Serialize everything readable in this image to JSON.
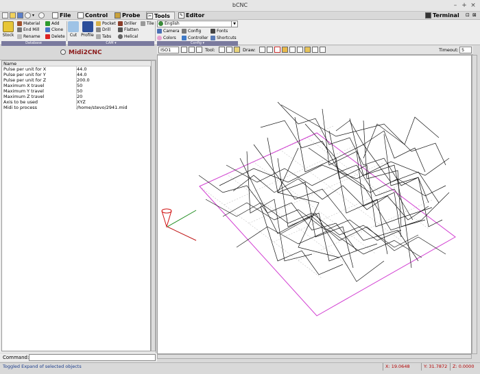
{
  "window": {
    "title": "bCNC"
  },
  "menu": {
    "tabs": [
      {
        "label": "File",
        "icon": "file-icon"
      },
      {
        "label": "Control",
        "icon": "control-icon"
      },
      {
        "label": "Probe",
        "icon": "probe-icon"
      },
      {
        "label": "Tools",
        "icon": "tools-icon"
      },
      {
        "label": "Editor",
        "icon": "editor-icon"
      }
    ],
    "terminal_label": "Terminal"
  },
  "ribbon": {
    "database": {
      "group_label": "Database",
      "stock_label": "Stock",
      "material_label": "Material",
      "endmill_label": "End Mill",
      "rename_label": "Rename",
      "add_label": "Add",
      "clone_label": "Clone",
      "delete_label": "Delete"
    },
    "cam": {
      "group_label": "CAM",
      "cut_label": "Cut",
      "profile_label": "Profile",
      "pocket_label": "Pocket",
      "drill_label": "Drill",
      "tabs_label": "Tabs",
      "driller_label": "Driller",
      "flatten_label": "Flatten",
      "helical_label": "Helical",
      "tile_label": "Tile"
    },
    "config": {
      "group_label": "Config",
      "language": "English",
      "camera_label": "Camera",
      "colors_label": "Colors",
      "config_label": "Config",
      "controller_label": "Controller",
      "fonts_label": "Fonts",
      "shortcuts_label": "Shortcuts"
    }
  },
  "panel": {
    "title": "Midi2CNC",
    "header_name": "Name",
    "rows": [
      {
        "key": "Pulse per unit for X",
        "value": "44.0"
      },
      {
        "key": "Pulse per unit for Y",
        "value": "44.0"
      },
      {
        "key": "Pulse per unit for Z",
        "value": "200.0"
      },
      {
        "key": "Maximum X travel",
        "value": "50"
      },
      {
        "key": "Maximum Y travel",
        "value": "50"
      },
      {
        "key": "Maximum Z travel",
        "value": "20"
      },
      {
        "key": "Axis to be used",
        "value": "XYZ"
      },
      {
        "key": "Midi to process",
        "value": "/home/stevo/2941.mid"
      }
    ]
  },
  "viewbar": {
    "view": "ISO1",
    "tool_label": "Tool:",
    "draw_label": "Draw:",
    "timeout_label": "Timeout:",
    "timeout_value": "5"
  },
  "command": {
    "label": "Command:"
  },
  "status": {
    "message": "Toggled Expand of selected objects",
    "x": "X: 19.0648",
    "y": "Y: 31.7872",
    "z": "Z: 0.0000"
  }
}
